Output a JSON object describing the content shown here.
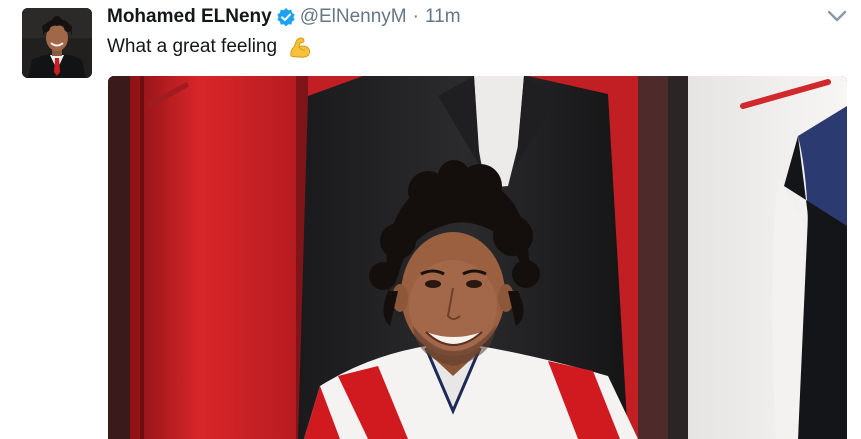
{
  "tweet": {
    "author_name": "Mohamed ELNeny",
    "handle": "@ElNennyM",
    "separator": "·",
    "time": "11m",
    "text": "What a great feeling",
    "emoji_icon": "flexed-biceps-icon",
    "verified_icon": "verified-badge-icon",
    "menu_icon": "chevron-down-icon"
  },
  "colors": {
    "name": "#14171a",
    "meta": "#657786",
    "verified": "#1da1f2",
    "accent_red": "#d01a20"
  }
}
